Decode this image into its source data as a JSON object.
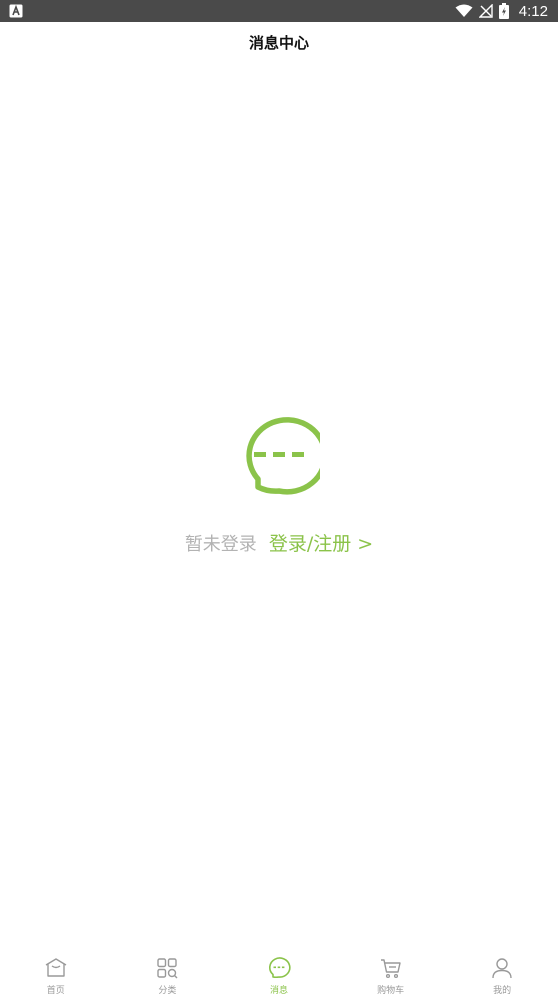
{
  "status_bar": {
    "time": "4:12",
    "left_icon": "a-notification-icon"
  },
  "header": {
    "title": "消息中心"
  },
  "empty_state": {
    "icon": "chat-bubble-icon",
    "message": "暂未登录",
    "login_link": "登录/注册 >"
  },
  "bottom_nav": {
    "items": [
      {
        "label": "首页",
        "icon": "home-icon",
        "active": false
      },
      {
        "label": "分类",
        "icon": "category-icon",
        "active": false
      },
      {
        "label": "消息",
        "icon": "message-icon",
        "active": true
      },
      {
        "label": "购物车",
        "icon": "cart-icon",
        "active": false
      },
      {
        "label": "我的",
        "icon": "user-icon",
        "active": false
      }
    ]
  },
  "colors": {
    "accent": "#8bc34a",
    "status_bar": "#4a4a4a",
    "muted_text": "#b3b3b3",
    "nav_inactive": "#999999"
  }
}
